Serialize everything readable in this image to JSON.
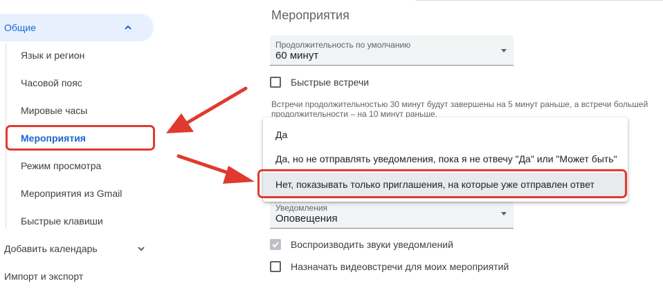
{
  "sidebar": {
    "general": "Общие",
    "items": [
      "Язык и регион",
      "Часовой пояс",
      "Мировые часы",
      "Мероприятия",
      "Режим просмотра",
      "Мероприятия из Gmail",
      "Быстрые клавиши"
    ],
    "add_calendar": "Добавить календарь",
    "import_export": "Импорт и экспорт"
  },
  "main": {
    "section_title": "Мероприятия",
    "duration": {
      "label": "Продолжительность по умолчанию",
      "value": "60 минут"
    },
    "fast_meetings": {
      "label": "Быстрые встречи",
      "checked": false
    },
    "helper_text": "Встречи продолжительностью 30 минут будут завершены на 5 минут раньше, а встречи большей продолжительности – на 10 минут раньше.",
    "notifications": {
      "label": "Уведомления",
      "value": "Оповещения"
    },
    "play_sounds": {
      "label": "Воспроизводить звуки уведомлений",
      "checked": true,
      "disabled": true
    },
    "video_meetings": {
      "label": "Назначать видеовстречи для моих мероприятий",
      "checked": false
    }
  },
  "dropdown": {
    "options": [
      "Да",
      "Да, но не отправлять уведомления, пока я не отвечу \"Да\" или \"Может быть\"",
      "Нет, показывать только приглашения, на которые уже отправлен ответ"
    ],
    "selected_index": 2
  },
  "colors": {
    "accent": "#1967d2",
    "active_bg": "#e8f0fe",
    "annotation_red": "#e03a2f"
  }
}
